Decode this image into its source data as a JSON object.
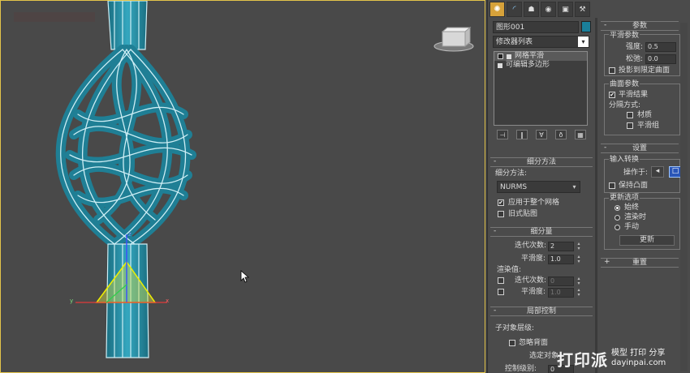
{
  "command_panel": {
    "object_name": "图形001",
    "object_color": "#1a7f9a",
    "modifier_list_label": "修改器列表",
    "stack_items": [
      {
        "label": "网格平滑",
        "selected": true
      },
      {
        "label": "可编辑多边形",
        "selected": false
      }
    ]
  },
  "params_rollout": {
    "title": "参数",
    "smooth_params_label": "平滑参数",
    "strength_label": "强度:",
    "strength_value": "0.5",
    "relax_label": "松弛:",
    "relax_value": "0.0",
    "project_label": "投影到限定曲面",
    "surface_params_label": "曲面参数",
    "smooth_result_label": "平滑结果",
    "smooth_result_checked": true,
    "separate_by_label": "分隔方式:",
    "materials_label": "材质",
    "smoothing_groups_label": "平滑组"
  },
  "settings_rollout": {
    "title": "设置",
    "input_conversion_label": "输入转换",
    "operate_on_label": "操作于:",
    "keep_convex_label": "保持凸面",
    "update_options_label": "更新选项",
    "update_radios": [
      {
        "label": "始终",
        "on": true
      },
      {
        "label": "渲染时",
        "on": false
      },
      {
        "label": "手动",
        "on": false
      }
    ],
    "update_button_label": "更新"
  },
  "reset_rollout": {
    "title": "重置"
  },
  "subdivision_method_rollout": {
    "title": "细分方法",
    "method_label": "细分方法:",
    "method_value": "NURMS",
    "apply_to_whole_label": "应用于整个网格",
    "apply_to_whole_checked": true,
    "old_mapping_label": "旧式贴图"
  },
  "subdivision_amount_rollout": {
    "title": "细分量",
    "iterations_label": "迭代次数:",
    "iterations_value": "2",
    "smoothness_label": "平滑度:",
    "smoothness_value": "1.0",
    "render_values_label": "渲染值:",
    "render_iterations_label": "迭代次数:",
    "render_iterations_value": "0",
    "render_smoothness_label": "平滑度:",
    "render_smoothness_value": "1.0"
  },
  "local_control_rollout": {
    "title": "局部控制",
    "sub_object_level_label": "子对象层级:",
    "ignore_backfacing_label": "忽略背面",
    "selected_objects_label": "选定对象",
    "control_level_label": "控制级别:",
    "control_level_value": "0"
  },
  "watermark": {
    "big": "打印派",
    "line1": "模型 打印 分享",
    "line2": "dayinpai.com"
  },
  "colors": {
    "accent": "#d7a23a",
    "mesh": "#2a8fa6",
    "mesh_highlight": "#cdeef5",
    "viewport_border": "#e3c44a"
  }
}
